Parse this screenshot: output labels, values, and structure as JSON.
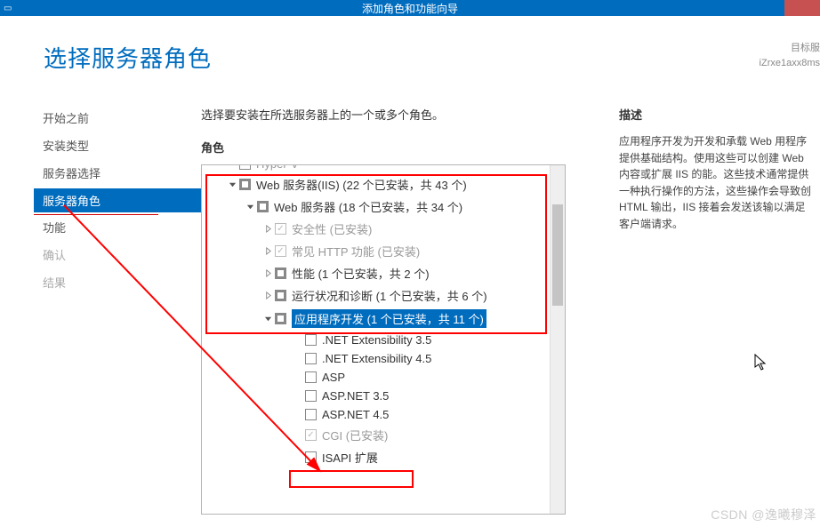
{
  "titlebar": {
    "title": "添加角色和功能向导"
  },
  "header": {
    "page_title": "选择服务器角色",
    "target_label": "目标服",
    "target_host": "iZrxe1axx8ms"
  },
  "sidebar": {
    "items": [
      {
        "label": "开始之前",
        "state": "normal"
      },
      {
        "label": "安装类型",
        "state": "normal"
      },
      {
        "label": "服务器选择",
        "state": "normal"
      },
      {
        "label": "服务器角色",
        "state": "active"
      },
      {
        "label": "功能",
        "state": "normal"
      },
      {
        "label": "确认",
        "state": "disabled"
      },
      {
        "label": "结果",
        "state": "disabled"
      }
    ]
  },
  "center": {
    "instruction": "选择要安装在所选服务器上的一个或多个角色。",
    "roles_label": "角色",
    "tree": [
      {
        "indent": 28,
        "exp": "expanded",
        "cb": "filled",
        "label": "Web 服务器(IIS) (22 个已安装，共 43 个)"
      },
      {
        "indent": 48,
        "exp": "expanded",
        "cb": "filled",
        "label": "Web 服务器 (18 个已安装，共 34 个)"
      },
      {
        "indent": 68,
        "exp": "collapsed",
        "cb": "checked-disabled",
        "label": "安全性 (已安装)",
        "disabled": true
      },
      {
        "indent": 68,
        "exp": "collapsed",
        "cb": "checked-disabled",
        "label": "常见 HTTP 功能 (已安装)",
        "disabled": true
      },
      {
        "indent": 68,
        "exp": "collapsed",
        "cb": "filled",
        "label": "性能 (1 个已安装，共 2 个)"
      },
      {
        "indent": 68,
        "exp": "collapsed",
        "cb": "filled",
        "label": "运行状况和诊断 (1 个已安装，共 6 个)"
      },
      {
        "indent": 68,
        "exp": "expanded",
        "cb": "filled",
        "label": "应用程序开发 (1 个已安装，共 11 个)",
        "selected": true
      },
      {
        "indent": 102,
        "exp": "",
        "cb": "empty",
        "label": ".NET Extensibility 3.5"
      },
      {
        "indent": 102,
        "exp": "",
        "cb": "empty",
        "label": ".NET Extensibility 4.5"
      },
      {
        "indent": 102,
        "exp": "",
        "cb": "empty",
        "label": "ASP"
      },
      {
        "indent": 102,
        "exp": "",
        "cb": "empty",
        "label": "ASP.NET 3.5"
      },
      {
        "indent": 102,
        "exp": "",
        "cb": "empty",
        "label": "ASP.NET 4.5"
      },
      {
        "indent": 102,
        "exp": "",
        "cb": "checked-disabled",
        "label": "CGI (已安装)",
        "disabled": true
      },
      {
        "indent": 102,
        "exp": "",
        "cb": "empty",
        "label": "ISAPI 扩展"
      }
    ],
    "truncated_top": "Hyper-V"
  },
  "desc": {
    "title": "描述",
    "text": "应用程序开发为开发和承载 Web 用程序提供基础结构。使用这些可以创建 Web 内容或扩展 IIS 的能。这些技术通常提供一种执行操作的方法，这些操作会导致创 HTML 输出，IIS 接着会发送该输以满足客户端请求。"
  },
  "watermark": "CSDN @逸曦穆泽"
}
